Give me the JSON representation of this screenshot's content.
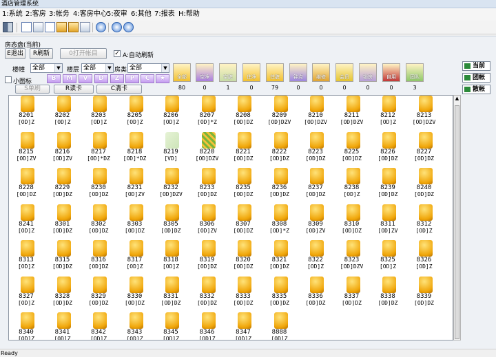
{
  "title": "酒店管理系统",
  "menu": [
    "1:系统",
    "2:客房",
    "3:帐务",
    "4:客房中心",
    "5:夜审",
    "6:其他",
    "7:报表",
    "H:帮助"
  ],
  "toolbar_icons": [
    "exit-icon",
    "edit-icon",
    "document-icon",
    "card-icon",
    "book-icon",
    "book-icon",
    "guest-icon",
    "refresh-icon",
    "search-icon",
    "help-icon"
  ],
  "panel": {
    "title": "房态盘(当前)",
    "btn_exit": "E退出",
    "btn_refresh": "R刷新",
    "btn_open": "0打开帐目",
    "auto_refresh": "A:自动刷新",
    "small_icon": "小图标",
    "btn_s_single": "S单刷",
    "btn_read_card": "R读卡",
    "btn_clear_card": "C清卡",
    "building_label": "楼幢",
    "floor_label": "楼层",
    "type_label": "房类",
    "building_value": "全部",
    "floor_value": "全部",
    "type_value": "全部",
    "letters": [
      "B",
      "M",
      "V",
      "D",
      "Z",
      "P",
      "C",
      "★"
    ]
  },
  "statuses": [
    {
      "label": "全部",
      "count": "80",
      "color": "#f3c12f"
    },
    {
      "label": "空净",
      "count": "0",
      "color": "#a97ee0"
    },
    {
      "label": "空脏",
      "count": "1",
      "color": "#c7dca8"
    },
    {
      "label": "住净",
      "count": "0",
      "color": "#f3c12f"
    },
    {
      "label": "住脏",
      "count": "79",
      "color": "#f3c12f"
    },
    {
      "label": "钟点",
      "count": "0",
      "color": "#9d86e0"
    },
    {
      "label": "维修",
      "count": "0",
      "color": "#e1a431"
    },
    {
      "label": "会员",
      "count": "0",
      "color": "#e6c530"
    },
    {
      "label": "锁房",
      "count": "0",
      "color": "#b69fd8"
    },
    {
      "label": "自用",
      "count": "0",
      "color": "#c23737"
    },
    {
      "label": "团队",
      "count": "3",
      "color": "#8fc86a"
    }
  ],
  "side_buttons": [
    "当前",
    "团帐",
    "散帐"
  ],
  "rooms": [
    {
      "n": "8201",
      "c": "[OD]Z",
      "s": 0
    },
    {
      "n": "8202",
      "c": "[OD]Z",
      "s": 0
    },
    {
      "n": "8203",
      "c": "[OD]Z",
      "s": 0
    },
    {
      "n": "8205",
      "c": "[OD]Z",
      "s": 0
    },
    {
      "n": "8206",
      "c": "[OD]Z",
      "s": 0
    },
    {
      "n": "8207",
      "c": "[OD]*Z",
      "s": 0
    },
    {
      "n": "8208",
      "c": "[OD]DZ",
      "s": 0
    },
    {
      "n": "8209",
      "c": "[OD]DZV",
      "s": 0
    },
    {
      "n": "8210",
      "c": "[OD]DZV",
      "s": 0
    },
    {
      "n": "8211",
      "c": "[OD]DZV",
      "s": 0
    },
    {
      "n": "8212",
      "c": "[OD]Z",
      "s": 0
    },
    {
      "n": "8213",
      "c": "[OD]DZV",
      "s": 0
    },
    {
      "n": "8215",
      "c": "[OD]ZV",
      "s": 0
    },
    {
      "n": "8216",
      "c": "[OD]ZV",
      "s": 0
    },
    {
      "n": "8217",
      "c": "[OD]*DZ",
      "s": 0
    },
    {
      "n": "8218",
      "c": "[OD]*DZ",
      "s": 0
    },
    {
      "n": "8219",
      "c": "[VD]",
      "s": 1
    },
    {
      "n": "8220",
      "c": "[OD]DZV",
      "s": 2
    },
    {
      "n": "8221",
      "c": "[OD]DZ",
      "s": 0
    },
    {
      "n": "8222",
      "c": "[OD]DZ",
      "s": 0
    },
    {
      "n": "8223",
      "c": "[OD]DZ",
      "s": 0
    },
    {
      "n": "8225",
      "c": "[OD]DZ",
      "s": 0
    },
    {
      "n": "8226",
      "c": "[OD]DZ",
      "s": 0
    },
    {
      "n": "8227",
      "c": "[OD]DZ",
      "s": 0
    },
    {
      "n": "8228",
      "c": "[OD]DZ",
      "s": 0
    },
    {
      "n": "8229",
      "c": "[OD]DZ",
      "s": 0
    },
    {
      "n": "8230",
      "c": "[OD]DZ",
      "s": 0
    },
    {
      "n": "8231",
      "c": "[OD]ZV",
      "s": 0
    },
    {
      "n": "8232",
      "c": "[OD]DZV",
      "s": 0
    },
    {
      "n": "8233",
      "c": "[OD]DZ",
      "s": 0
    },
    {
      "n": "8235",
      "c": "[OD]DZ",
      "s": 0
    },
    {
      "n": "8236",
      "c": "[OD]DZ",
      "s": 0
    },
    {
      "n": "8237",
      "c": "[OD]DZ",
      "s": 0
    },
    {
      "n": "8238",
      "c": "[OD]Z",
      "s": 0
    },
    {
      "n": "8239",
      "c": "[OD]DZ",
      "s": 0
    },
    {
      "n": "8240",
      "c": "[OD]DZ",
      "s": 0
    },
    {
      "n": "8241",
      "c": "[OD]Z",
      "s": 0
    },
    {
      "n": "8301",
      "c": "[OD]DZ",
      "s": 0
    },
    {
      "n": "8302",
      "c": "[OD]DZ",
      "s": 0
    },
    {
      "n": "8303",
      "c": "[OD]DZ",
      "s": 0
    },
    {
      "n": "8305",
      "c": "[OD]DZ",
      "s": 0
    },
    {
      "n": "8306",
      "c": "[OD]ZV",
      "s": 0
    },
    {
      "n": "8307",
      "c": "[OD]DZ",
      "s": 0
    },
    {
      "n": "8308",
      "c": "[OD]*Z",
      "s": 0
    },
    {
      "n": "8309",
      "c": "[OD]ZV",
      "s": 0
    },
    {
      "n": "8310",
      "c": "[OD]DZ",
      "s": 0
    },
    {
      "n": "8311",
      "c": "[OD]ZV",
      "s": 0
    },
    {
      "n": "8312",
      "c": "[OD]Z",
      "s": 0
    },
    {
      "n": "8313",
      "c": "[OD]Z",
      "s": 0
    },
    {
      "n": "8315",
      "c": "[OD]DZ",
      "s": 0
    },
    {
      "n": "8316",
      "c": "[OD]DZ",
      "s": 0
    },
    {
      "n": "8317",
      "c": "[OD]Z",
      "s": 0
    },
    {
      "n": "8318",
      "c": "[OD]Z",
      "s": 0
    },
    {
      "n": "8319",
      "c": "[OD]DZ",
      "s": 0
    },
    {
      "n": "8320",
      "c": "[OD]DZ",
      "s": 0
    },
    {
      "n": "8321",
      "c": "[OD]DZ",
      "s": 0
    },
    {
      "n": "8322",
      "c": "[OD]Z",
      "s": 0
    },
    {
      "n": "8323",
      "c": "[OD]DZV",
      "s": 0
    },
    {
      "n": "8325",
      "c": "[OD]Z",
      "s": 0
    },
    {
      "n": "8326",
      "c": "[OD]Z",
      "s": 0
    },
    {
      "n": "8327",
      "c": "[OD]Z",
      "s": 0
    },
    {
      "n": "8328",
      "c": "[OD]DZ",
      "s": 0
    },
    {
      "n": "8329",
      "c": "[OD]DZ",
      "s": 0
    },
    {
      "n": "8330",
      "c": "[OD]DZ",
      "s": 0
    },
    {
      "n": "8331",
      "c": "[OD]DZ",
      "s": 0
    },
    {
      "n": "8332",
      "c": "[OD]DZ",
      "s": 0
    },
    {
      "n": "8333",
      "c": "[OD]DZ",
      "s": 0
    },
    {
      "n": "8335",
      "c": "[OD]DZ",
      "s": 0
    },
    {
      "n": "8336",
      "c": "[OD]DZ",
      "s": 0
    },
    {
      "n": "8337",
      "c": "[OD]DZ",
      "s": 0
    },
    {
      "n": "8338",
      "c": "[OD]DZ",
      "s": 0
    },
    {
      "n": "8339",
      "c": "[OD]DZ",
      "s": 0
    },
    {
      "n": "8340",
      "c": "[OD]Z",
      "s": 0
    },
    {
      "n": "8341",
      "c": "[OD]Z",
      "s": 0
    },
    {
      "n": "8342",
      "c": "[OD]Z",
      "s": 0
    },
    {
      "n": "8343",
      "c": "[OD]Z",
      "s": 0
    },
    {
      "n": "8345",
      "c": "[OD]Z",
      "s": 0
    },
    {
      "n": "8346",
      "c": "[OD]Z",
      "s": 0
    },
    {
      "n": "8347",
      "c": "[OD]Z",
      "s": 0
    },
    {
      "n": "8888",
      "c": "[OD]Z",
      "s": 0
    }
  ],
  "status_text": "Ready"
}
